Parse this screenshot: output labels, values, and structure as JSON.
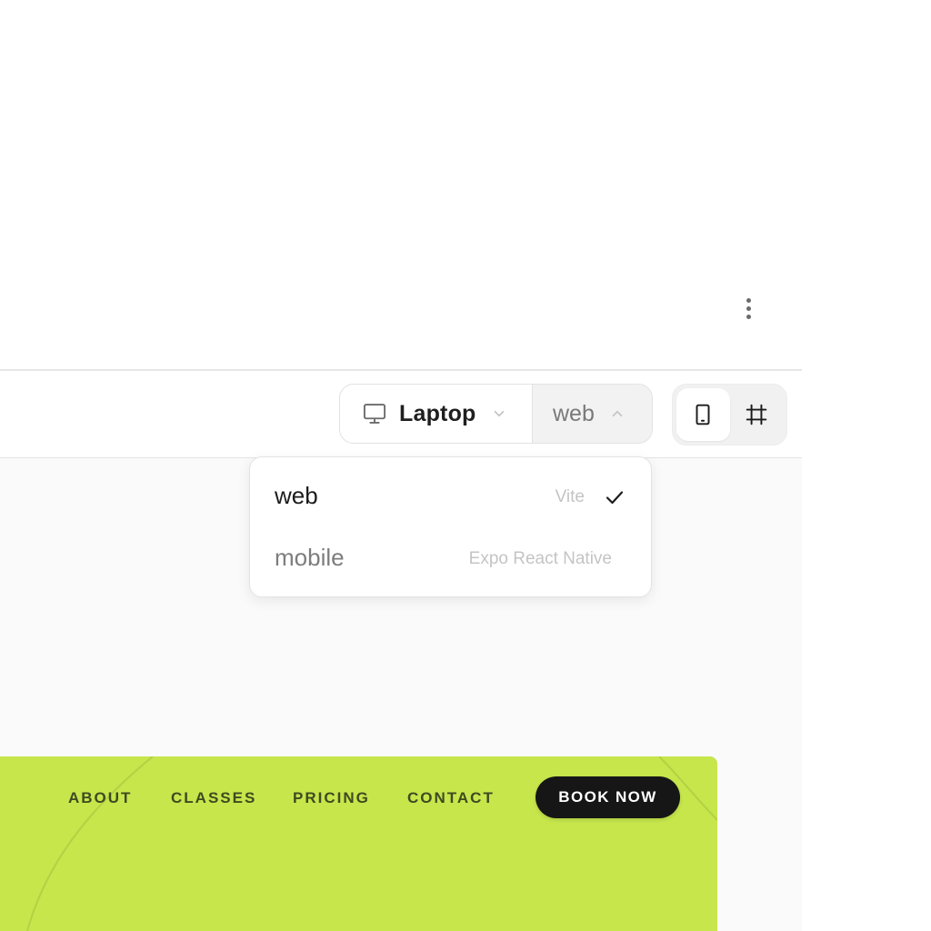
{
  "toolbar": {
    "device": {
      "label": "Laptop",
      "icon": "monitor-icon"
    },
    "platform": {
      "label": "web"
    },
    "view_toggle": {
      "items": [
        "tablet-icon",
        "frame-icon"
      ],
      "active": "tablet-icon"
    }
  },
  "dropdown": {
    "items": [
      {
        "label": "web",
        "meta": "Vite",
        "selected": true
      },
      {
        "label": "mobile",
        "meta": "Expo React Native",
        "selected": false
      }
    ]
  },
  "preview": {
    "background": "#c6e64c",
    "nav": {
      "links": [
        "ABOUT",
        "CLASSES",
        "PRICING",
        "CONTACT"
      ],
      "cta": "BOOK NOW"
    }
  },
  "menu": {
    "icon": "more-vertical-icon"
  }
}
